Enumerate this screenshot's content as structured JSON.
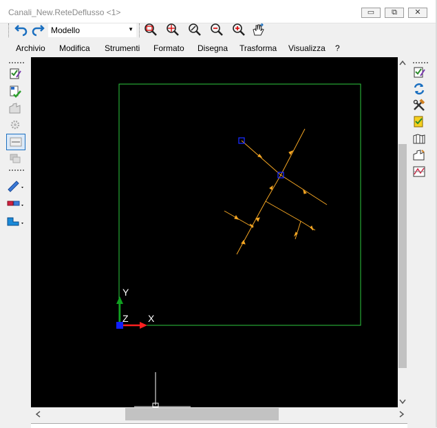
{
  "window": {
    "title": "Canali_New.ReteDeflusso <1>",
    "minimize": "▭",
    "maximize": "⧉",
    "close": "✕"
  },
  "toolbar": {
    "view_select": "Modello",
    "icons": [
      "undo-icon",
      "redo-icon",
      "zoom-window-icon",
      "zoom-extents-icon",
      "zoom-dynamic-icon",
      "zoom-out-icon",
      "zoom-in-icon",
      "pan-icon"
    ]
  },
  "menu": {
    "items": [
      "Archivio",
      "Modifica",
      "Strumenti",
      "Formato",
      "Disegna",
      "Trasforma",
      "Visualizza",
      "?"
    ]
  },
  "canvas": {
    "ucs_labels": {
      "x": "X",
      "y": "Y",
      "z": "Z"
    },
    "colors": {
      "background": "#000000",
      "frame": "#2ecc40",
      "network": "#f5a623",
      "node": "#1a2bff",
      "axis_x": "#ff2020",
      "axis_y": "#10a020",
      "axis_z": "#1020ff"
    }
  },
  "scroll": {
    "left_arrow": "<",
    "right_arrow": ">",
    "up_arrow": "^",
    "down_arrow": "v"
  }
}
